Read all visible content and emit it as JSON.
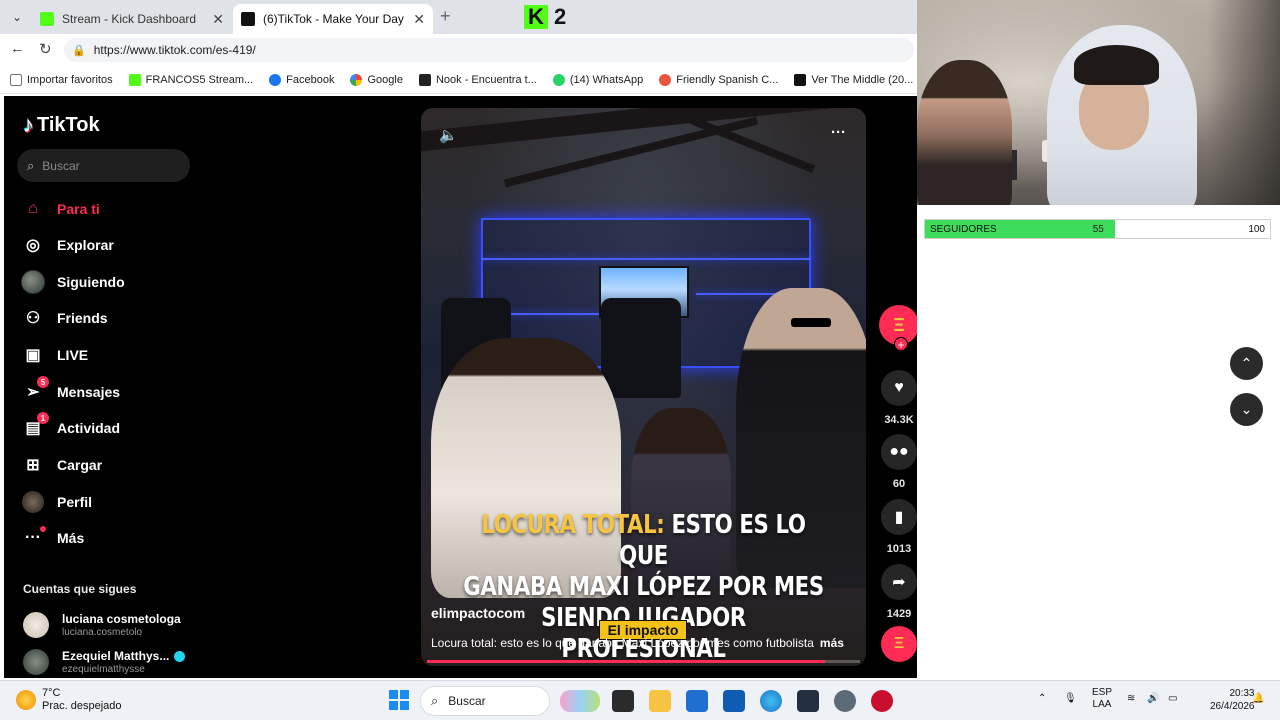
{
  "browser": {
    "tabs": [
      {
        "title": "Stream - Kick Dashboard",
        "color": "#53fc18"
      },
      {
        "title": "(6)TikTok - Make Your Day",
        "color": "#111111"
      }
    ],
    "kick_overlay_number": "2",
    "url": "https://www.tiktok.com/es-419/",
    "bookmarks": [
      {
        "label": "Importar favoritos",
        "color": "#777777"
      },
      {
        "label": "FRANCOS5 Stream...",
        "color": "#53fc18"
      },
      {
        "label": "Facebook",
        "color": "#1877f2"
      },
      {
        "label": "Google",
        "color": "#ea4335"
      },
      {
        "label": "Nook - Encuentra t...",
        "color": "#222222"
      },
      {
        "label": "(14) WhatsApp",
        "color": "#25d366"
      },
      {
        "label": "Friendly Spanish C...",
        "color": "#e8553c"
      },
      {
        "label": "Ver The Middle (20...",
        "color": "#111111"
      }
    ]
  },
  "tiktok": {
    "brand": "TikTok",
    "search_placeholder": "Buscar",
    "nav": [
      {
        "label": "Para ti",
        "icon": "home-icon"
      },
      {
        "label": "Explorar",
        "icon": "compass-icon"
      },
      {
        "label": "Siguiendo",
        "icon": "following-avatar-icon"
      },
      {
        "label": "Friends",
        "icon": "friends-icon"
      },
      {
        "label": "LIVE",
        "icon": "live-icon"
      },
      {
        "label": "Mensajes",
        "icon": "messages-icon",
        "badge": "5"
      },
      {
        "label": "Actividad",
        "icon": "activity-icon",
        "badge": "1"
      },
      {
        "label": "Cargar",
        "icon": "upload-icon"
      },
      {
        "label": "Perfil",
        "icon": "profile-icon"
      },
      {
        "label": "Más",
        "icon": "more-icon"
      }
    ],
    "following_title": "Cuentas que sigues",
    "following": [
      {
        "name": "luciana cosmetologa",
        "handle": "luciana.cosmetolo"
      },
      {
        "name": "Ezequiel Matthys...",
        "handle": "ezequielmatthysse"
      }
    ],
    "video": {
      "headline_highlight": "LOCURA TOTAL:",
      "headline_rest_1": "ESTO ES LO QUE",
      "headline_line_2": "GANABA MAXI LÓPEZ POR MES",
      "headline_line_3": "SIENDO JUGADOR PROFESIONAL",
      "author": "elimpactocom",
      "description": "Locura total: esto es lo que ganaba Maxi López por mes como futbolista",
      "more_label": "más",
      "watermark": "El impacto",
      "progress": 0.92
    },
    "actions": {
      "likes": "34.3K",
      "comments": "60",
      "saves": "1013",
      "shares": "1429"
    }
  },
  "overlay": {
    "followers_label": "SEGUIDORES",
    "followers_current": 55,
    "followers_goal": 100
  },
  "taskbar": {
    "temperature": "7°C",
    "weather": "Prac. despejado",
    "search_label": "Buscar",
    "lang_top": "ESP",
    "lang_bottom": "LAA",
    "time": "20:33",
    "date": "26/4/2026"
  }
}
